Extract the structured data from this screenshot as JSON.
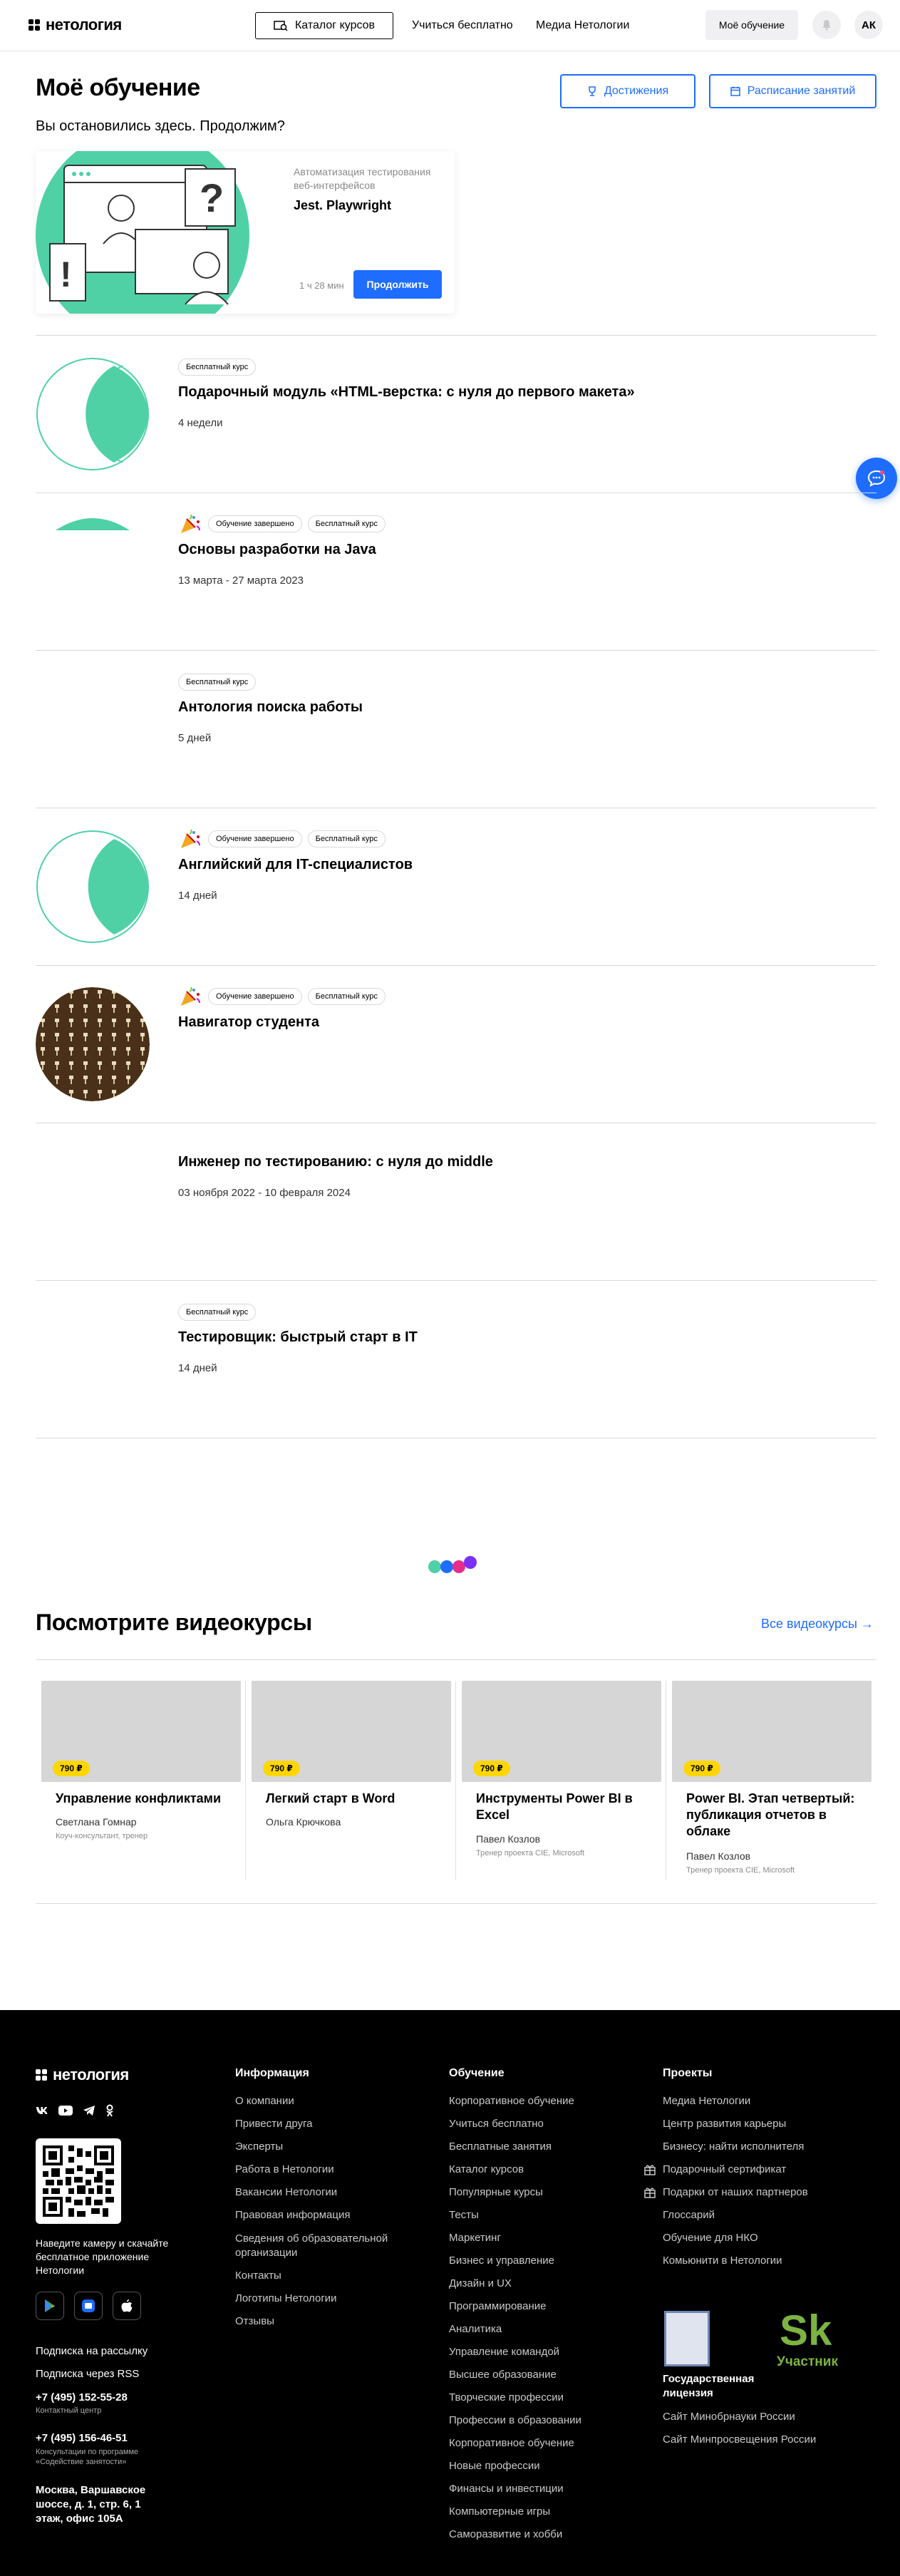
{
  "header": {
    "logo": "нетология",
    "catalog": "Каталог курсов",
    "nav": [
      "Учиться бесплатно",
      "Медиа Нетологии"
    ],
    "my_learning": "Моё обучение",
    "avatar": "АК"
  },
  "page": {
    "title": "Моё обучение",
    "achievements": "Достижения",
    "schedule": "Расписание занятий",
    "continue_question": "Вы остановились здесь. Продолжим?"
  },
  "continue_card": {
    "category": "Автоматизация тестирования веб-интерфейсов",
    "title": "Jest. Playwright",
    "time": "1 ч 28 мин",
    "button": "Продолжить"
  },
  "courses": [
    {
      "badges": [
        "Бесплатный курс"
      ],
      "completed": false,
      "title": "Подарочный модуль «HTML-верстка: с нуля до первого макета»",
      "meta": "4 недели"
    },
    {
      "badges": [
        "Обучение завершено",
        "Бесплатный курс"
      ],
      "completed": true,
      "title": "Основы разработки на Java",
      "meta": "13 марта - 27 марта 2023"
    },
    {
      "badges": [
        "Бесплатный курс"
      ],
      "completed": false,
      "title": "Антология поиска работы",
      "meta": "5 дней"
    },
    {
      "badges": [
        "Обучение завершено",
        "Бесплатный курс"
      ],
      "completed": true,
      "title": "Английский для IT-специалистов",
      "meta": "14 дней"
    },
    {
      "badges": [
        "Обучение завершено",
        "Бесплатный курс"
      ],
      "completed": true,
      "title": "Навигатор студента",
      "meta": ""
    },
    {
      "badges": [],
      "completed": false,
      "title": "Инженер по тестированию: с нуля до middle",
      "meta": "03 ноября 2022 - 10 февраля 2024"
    },
    {
      "badges": [
        "Бесплатный курс"
      ],
      "completed": false,
      "title": "Тестировщик: быстрый старт в IT",
      "meta": "14 дней"
    }
  ],
  "videos": {
    "title": "Посмотрите видеокурсы",
    "all_link": "Все видеокурсы →",
    "items": [
      {
        "price": "790 ₽",
        "title": "Управление конфликтами",
        "author": "Светлана Гомнар",
        "role": "Коуч-консультант, тренер"
      },
      {
        "price": "790 ₽",
        "title": "Легкий старт в Word",
        "author": "Ольга Крючкова",
        "role": ""
      },
      {
        "price": "790 ₽",
        "title": "Инструменты Power BI в Excel",
        "author": "Павел Козлов",
        "role": "Тренер проекта CIE, Microsoft"
      },
      {
        "price": "790 ₽",
        "title": "Power BI. Этап четвертый: публикация отчетов в облаке",
        "author": "Павел Козлов",
        "role": "Тренер проекта CIE, Microsoft"
      }
    ]
  },
  "footer": {
    "logo": "нетология",
    "qr_caption": "Наведите камеру и скачайте бесплатное приложение Нетологии",
    "newsletter": "Подписка на рассылку",
    "rss": "Подписка через RSS",
    "phone1": "+7 (495) 152-55-28",
    "phone1_note": "Контактный центр",
    "phone2": "+7 (495) 156-46-51",
    "phone2_note": "Консультации по программе «Содействие занятости»",
    "address": "Москва, Варшавское шоссе, д. 1, стр. 6, 1 этаж, офис 105А",
    "info": {
      "title": "Информация",
      "links": [
        "О компании",
        "Привести друга",
        "Эксперты",
        "Работа в Нетологии",
        "Вакансии Нетологии",
        "Правовая информация",
        "Сведения об образовательной организации",
        "Контакты",
        "Логотипы Нетологии",
        "Отзывы"
      ]
    },
    "learning": {
      "title": "Обучение",
      "links": [
        "Корпоративное обучение",
        "Учиться бесплатно",
        "Бесплатные занятия",
        "Каталог курсов",
        "Популярные курсы",
        "Тесты",
        "Маркетинг",
        "Бизнес и управление",
        "Дизайн и UX",
        "Программирование",
        "Аналитика",
        "Управление командой",
        "Высшее образование",
        "Творческие профессии",
        "Профессии в образовании",
        "Корпоративное обучение",
        "Новые профессии",
        "Финансы и инвестиции",
        "Компьютерные игры",
        "Саморазвитие и хобби"
      ]
    },
    "projects": {
      "title": "Проекты",
      "links": [
        "Медиа Нетологии",
        "Центр развития карьеры",
        "Бизнесу: найти исполнителя",
        "Подарочный сертификат",
        "Подарки от наших партнеров",
        "Глоссарий",
        "Обучение для НКО",
        "Комьюнити в Нетологии"
      ]
    },
    "license": "Государственная лицензия",
    "skolkovo": "Участник",
    "gov_links": [
      "Сайт Минобрнауки России",
      "Сайт Минпросвещения России"
    ]
  },
  "colors": {
    "accent": "#1e6dff",
    "mint": "#4fd1a5",
    "price": "#ffd600"
  }
}
